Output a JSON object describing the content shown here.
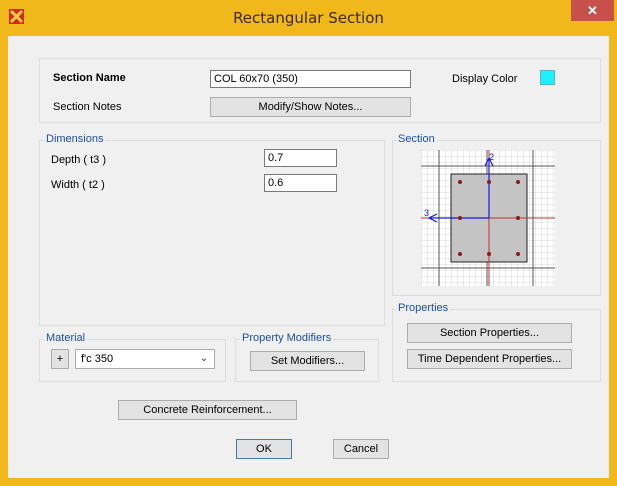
{
  "window": {
    "title": "Rectangular Section",
    "app_icon": "section-app-icon",
    "close_glyph": "✕"
  },
  "section": {
    "name_label": "Section Name",
    "name_value": "COL 60x70 (350)",
    "display_color_label": "Display Color",
    "display_color": "#1ef0ff",
    "notes_label": "Section Notes",
    "notes_button": "Modify/Show Notes..."
  },
  "dimensions": {
    "group_label": "Dimensions",
    "depth_label": "Depth  ( t3 )",
    "depth_value": "0.7",
    "width_label": "Width  ( t2 )",
    "width_value": "0.6"
  },
  "section_preview": {
    "group_label": "Section",
    "axis_2": "2",
    "axis_3": "3"
  },
  "properties": {
    "group_label": "Properties",
    "section_properties_button": "Section Properties...",
    "time_dependent_button": "Time Dependent Properties..."
  },
  "material": {
    "group_label": "Material",
    "add_button": "+",
    "selected": "f'c 350"
  },
  "modifiers": {
    "group_label": "Property Modifiers",
    "button": "Set Modifiers..."
  },
  "reinforcement_button": "Concrete Reinforcement...",
  "footer": {
    "ok": "OK",
    "cancel": "Cancel"
  },
  "colors": {
    "title_bar": "#f0b81a",
    "close": "#c7504b",
    "group_label": "#1c4fa3"
  }
}
